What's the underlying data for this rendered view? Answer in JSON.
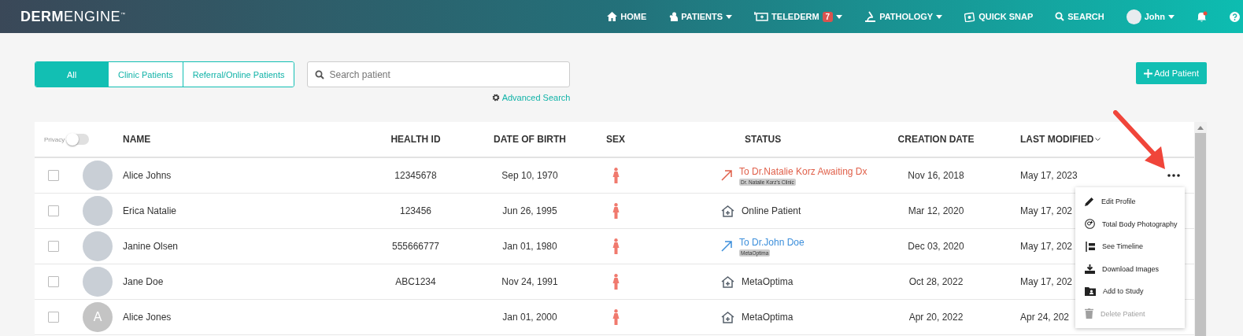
{
  "header": {
    "logo_bold": "DERM",
    "logo_light": "ENGINE",
    "logo_mark": "™",
    "nav": [
      {
        "kind": "home",
        "label": "HOME",
        "dropdown": false
      },
      {
        "kind": "patients",
        "label": "PATIENTS",
        "dropdown": true
      },
      {
        "kind": "telederm",
        "label": "TELEDERM",
        "badge": "7",
        "dropdown": true
      },
      {
        "kind": "pathology",
        "label": "PATHOLOGY",
        "dropdown": true
      },
      {
        "kind": "snap",
        "label": "QUICK SNAP",
        "dropdown": false
      },
      {
        "kind": "search",
        "label": "SEARCH",
        "dropdown": false
      },
      {
        "kind": "user",
        "label": "John",
        "dropdown": true
      },
      {
        "kind": "bell",
        "dropdown": false,
        "unread": true
      },
      {
        "kind": "help",
        "dropdown": false
      }
    ]
  },
  "filters": {
    "tabs": [
      {
        "label": "All",
        "selected": true
      },
      {
        "label": "Clinic Patients",
        "selected": false
      },
      {
        "label": "Referral/Online Patients",
        "selected": false
      }
    ],
    "search": {
      "placeholder": "Search patient"
    },
    "advanced_search": "Advanced Search"
  },
  "add_button": "Add Patient",
  "table": {
    "privacy": {
      "label": "Privacy",
      "on": false
    },
    "columns": [
      {
        "label": "NAME",
        "sorted": false
      },
      {
        "label": "HEALTH ID",
        "sorted": false
      },
      {
        "label": "DATE OF BIRTH",
        "sorted": false
      },
      {
        "label": "SEX",
        "sorted": false
      },
      {
        "label": "STATUS",
        "sorted": false
      },
      {
        "label": "CREATION DATE",
        "sorted": false
      },
      {
        "label": "LAST MODIFIED",
        "sorted": true
      }
    ],
    "rows": [
      {
        "checked": false,
        "name": "Alice Johns",
        "health_id": "12345678",
        "dob": "Sep 10, 1970",
        "status": {
          "kind": "referral",
          "text": "To Dr.Natalie Korz Awaiting Dx",
          "tag": "Dr. Natalie Korz's Clinic",
          "color": "#e0604a"
        },
        "created": "Nov 16, 2018",
        "modified": "May 17, 2023"
      },
      {
        "checked": false,
        "name": "Erica Natalie",
        "health_id": "123456",
        "dob": "Jun 26, 1995",
        "status": {
          "kind": "clinic",
          "text": "Online Patient"
        },
        "created": "Mar 12, 2020",
        "modified": "May 17, 202"
      },
      {
        "checked": false,
        "name": "Janine Olsen",
        "health_id": "555666777",
        "dob": "Jan 01, 1980",
        "status": {
          "kind": "referral",
          "text": "To Dr.John Doe",
          "tag": "MetaOptima",
          "color": "#3d8fdb"
        },
        "created": "Dec 03, 2020",
        "modified": "May 17, 202"
      },
      {
        "checked": false,
        "name": "Jane Doe",
        "health_id": "ABC1234",
        "dob": "Nov 24, 1991",
        "status": {
          "kind": "clinic",
          "text": "MetaOptima"
        },
        "created": "Oct 28, 2022",
        "modified": "May 17, 202"
      },
      {
        "checked": false,
        "initial": "A",
        "name": "Alice Jones",
        "dob": "Jan 01, 2000",
        "status": {
          "kind": "clinic",
          "text": "MetaOptima"
        },
        "created": "Apr 20, 2022",
        "modified": "Apr 24, 202"
      }
    ]
  },
  "row_menu": {
    "items": [
      {
        "kind": "edit",
        "label": "Edit Profile",
        "disabled": false
      },
      {
        "kind": "body",
        "label": "Total Body Photography",
        "disabled": false
      },
      {
        "kind": "timeline",
        "label": "See Timeline",
        "disabled": false
      },
      {
        "kind": "download",
        "label": "Download Images",
        "disabled": false
      },
      {
        "kind": "study",
        "label": "Add to Study",
        "disabled": false
      },
      {
        "kind": "delete",
        "label": "Delete Patient",
        "disabled": true
      }
    ]
  }
}
